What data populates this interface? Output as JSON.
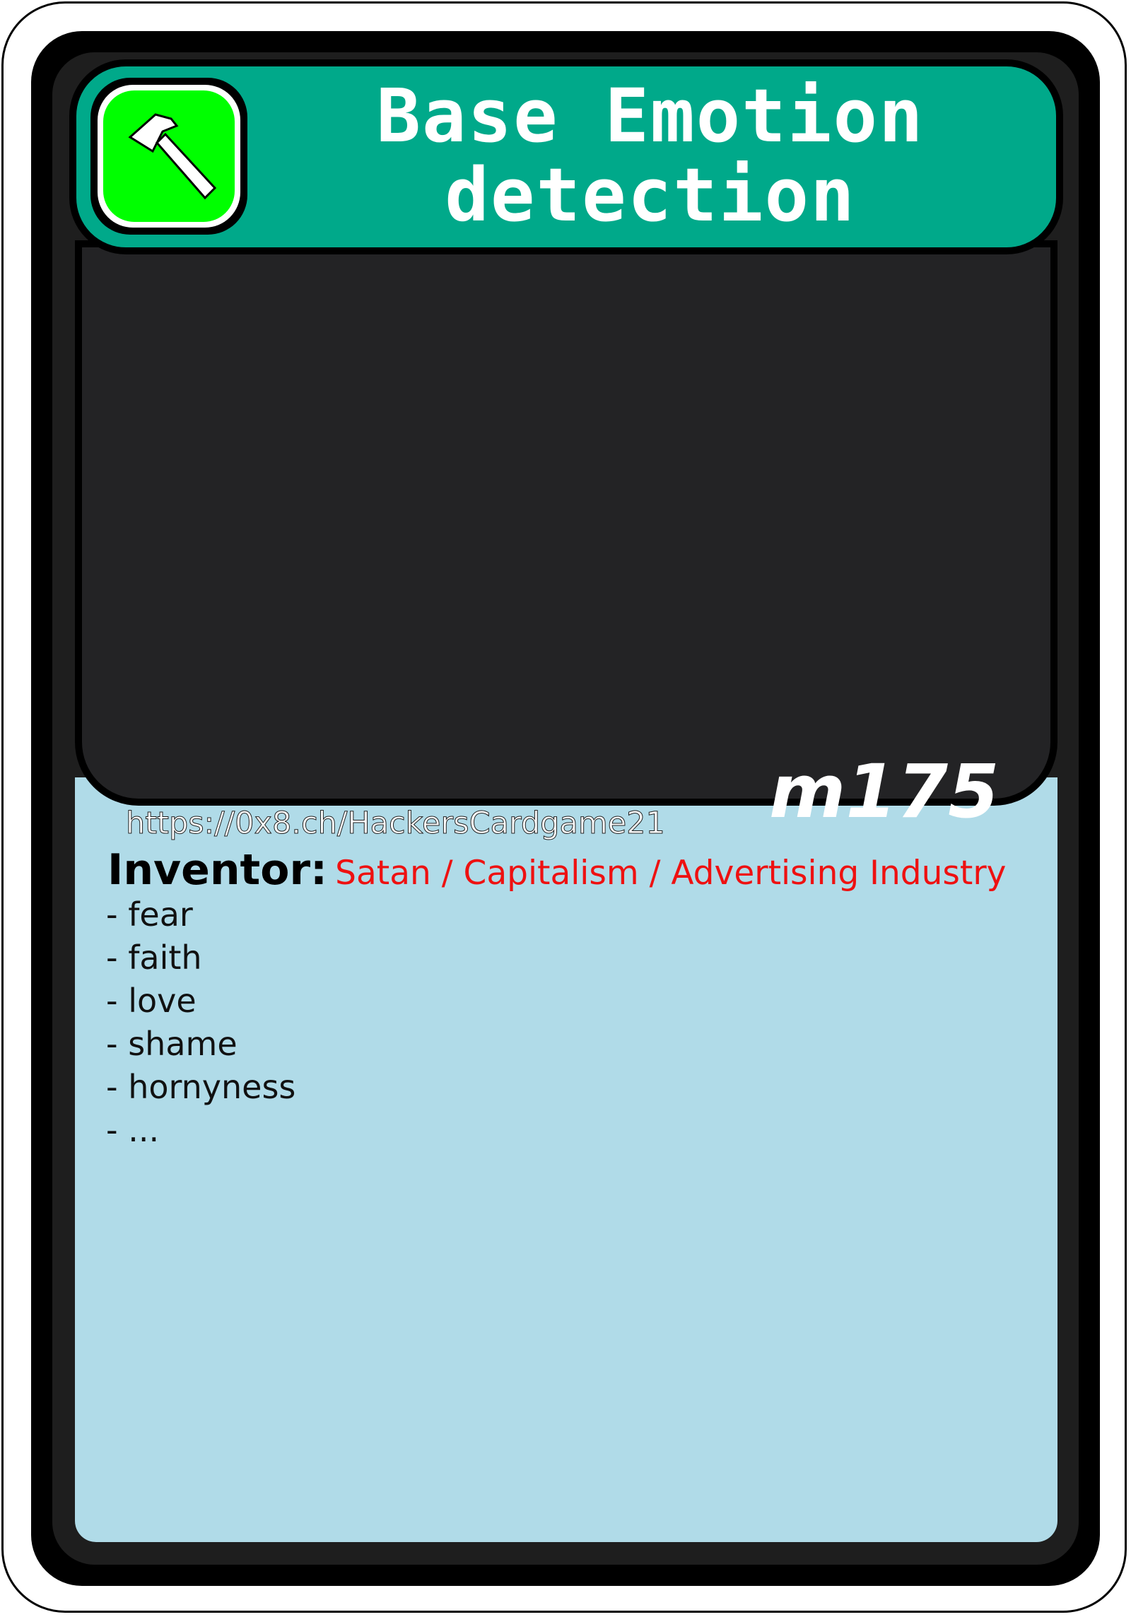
{
  "card": {
    "title_line1": "Base Emotion",
    "title_line2": "detection",
    "category_icon": "hammer-icon",
    "id": "m175",
    "url": "https://0x8.ch/HackersCardgame21",
    "inventor_label": "Inventor:",
    "inventor_value": "Satan / Capitalism / Advertising Industry",
    "items": [
      "- fear",
      "- faith",
      "- love",
      "- shame",
      "- hornyness",
      "- ..."
    ]
  },
  "colors": {
    "title_bar": "#00a98a",
    "badge": "#00ff00",
    "body_panel": "#b0dbe8",
    "art_area": "#232325",
    "inventor_value": "#ee1111"
  }
}
